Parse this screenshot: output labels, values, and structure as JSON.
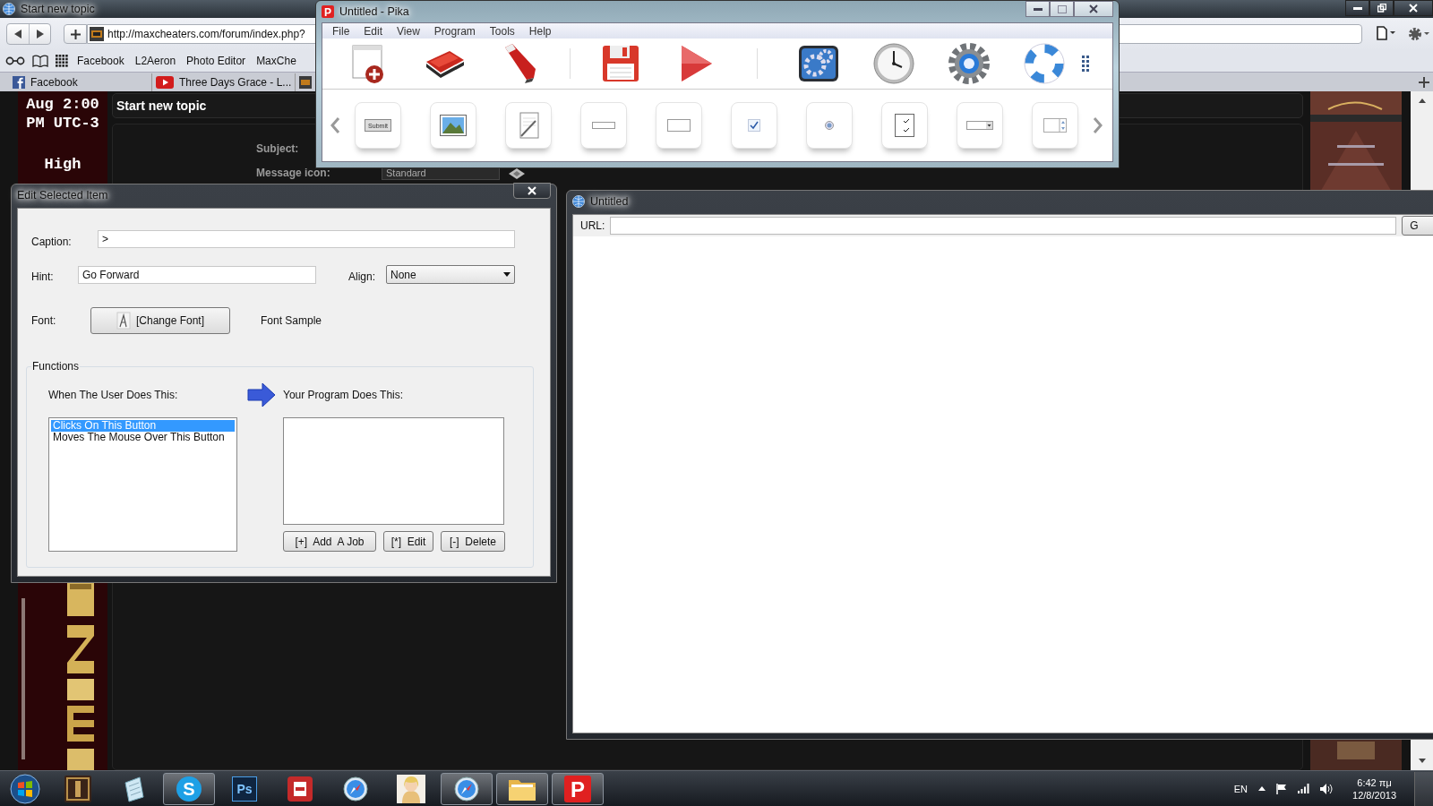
{
  "browser": {
    "title": "Start new topic",
    "url": "http://maxcheaters.com/forum/index.php?",
    "bookmarks": [
      "Facebook",
      "L2Aeron",
      "Photo Editor",
      "MaxChe"
    ],
    "tabs": [
      {
        "label": "Facebook",
        "kind": "facebook"
      },
      {
        "label": "Three Days Grace - L...",
        "kind": "video"
      }
    ],
    "page": {
      "clock_lines": [
        "Aug 2:00",
        "PM UTC-3"
      ],
      "status_text": "High",
      "panel_title": "Start new topic",
      "subject_label": "Subject:",
      "message_icon_label": "Message icon:",
      "message_icon_value": "Standard"
    }
  },
  "pika": {
    "icon_glyph": "P",
    "title": "Untitled - Pika",
    "menu": [
      "File",
      "Edit",
      "View",
      "Program",
      "Tools",
      "Help"
    ],
    "palette_button_text": "Submit"
  },
  "edit_dialog": {
    "title": "Edit Selected Item",
    "caption_label": "Caption:",
    "caption_value": ">",
    "hint_label": "Hint:",
    "hint_value": "Go Forward",
    "align_label": "Align:",
    "align_value": "None",
    "font_label": "Font:",
    "font_button": "[Change Font]",
    "font_sample": "Font Sample",
    "group_title": "Functions",
    "events_heading": "When The User Does This:",
    "actions_heading": "Your Program Does This:",
    "events": [
      {
        "label": "Clicks On This Button",
        "selected": true
      },
      {
        "label": "Moves The Mouse Over This Button",
        "selected": false
      }
    ],
    "buttons": [
      "[+]  Add  A Job",
      "[*]  Edit",
      "[-]  Delete"
    ]
  },
  "untitled_window": {
    "title": "Untitled",
    "url_label": "URL:",
    "go_button": "G"
  },
  "taskbar": {
    "apps": [
      {
        "kind": "lineage",
        "active": false
      },
      {
        "kind": "notes",
        "active": false
      },
      {
        "kind": "skype",
        "glyph": "S",
        "active": true
      },
      {
        "kind": "photoshop",
        "glyph": "Ps",
        "active": false
      },
      {
        "kind": "pdf",
        "active": false
      },
      {
        "kind": "safari",
        "active": false
      },
      {
        "kind": "figure",
        "active": false
      },
      {
        "kind": "safari",
        "active": true
      },
      {
        "kind": "folder",
        "active": true
      },
      {
        "kind": "pika",
        "glyph": "P",
        "active": true
      }
    ],
    "language": "EN",
    "time": "6:42 πμ",
    "date": "12/8/2013"
  }
}
